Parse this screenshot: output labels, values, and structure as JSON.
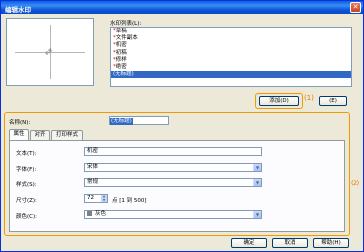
{
  "window": {
    "title": "编辑水印",
    "close_glyph": "✕"
  },
  "watermark_list": {
    "label": "水印列表(L):",
    "items": [
      {
        "mark": "*",
        "text": "草稿"
      },
      {
        "mark": "*",
        "text": "文件副本"
      },
      {
        "mark": "*",
        "text": "机密"
      },
      {
        "mark": "*",
        "text": "初稿"
      },
      {
        "mark": "*",
        "text": "修样"
      },
      {
        "mark": "*",
        "text": "绝密"
      },
      {
        "mark": "",
        "text": "(无标题)"
      }
    ],
    "selected_index": 6
  },
  "buttons": {
    "add": "添加(D)",
    "delete": "(E)",
    "ok": "确定",
    "cancel": "取消",
    "help": "帮助(H)"
  },
  "callouts": {
    "one": "(1)",
    "two": "(2)"
  },
  "name_field": {
    "label": "名称(N):",
    "value": "(无标题)"
  },
  "tabs": [
    {
      "label": "属性"
    },
    {
      "label": "对齐"
    },
    {
      "label": "打印样式"
    }
  ],
  "properties": {
    "text": {
      "label": "文本(T):",
      "value": "机密"
    },
    "font": {
      "label": "字体(F):",
      "value": "宋体"
    },
    "style": {
      "label": "样式(S):",
      "value": "常规"
    },
    "size": {
      "label": "尺寸(Z):",
      "value": "72",
      "range": "点 [1 到 500]"
    },
    "color": {
      "label": "颜色(C):",
      "value": "灰色",
      "swatch_color": "#808080"
    }
  },
  "colors": {
    "accent_orange": "#f39800",
    "selection": "#316ac5",
    "title_bar": "#0a5fe3"
  }
}
